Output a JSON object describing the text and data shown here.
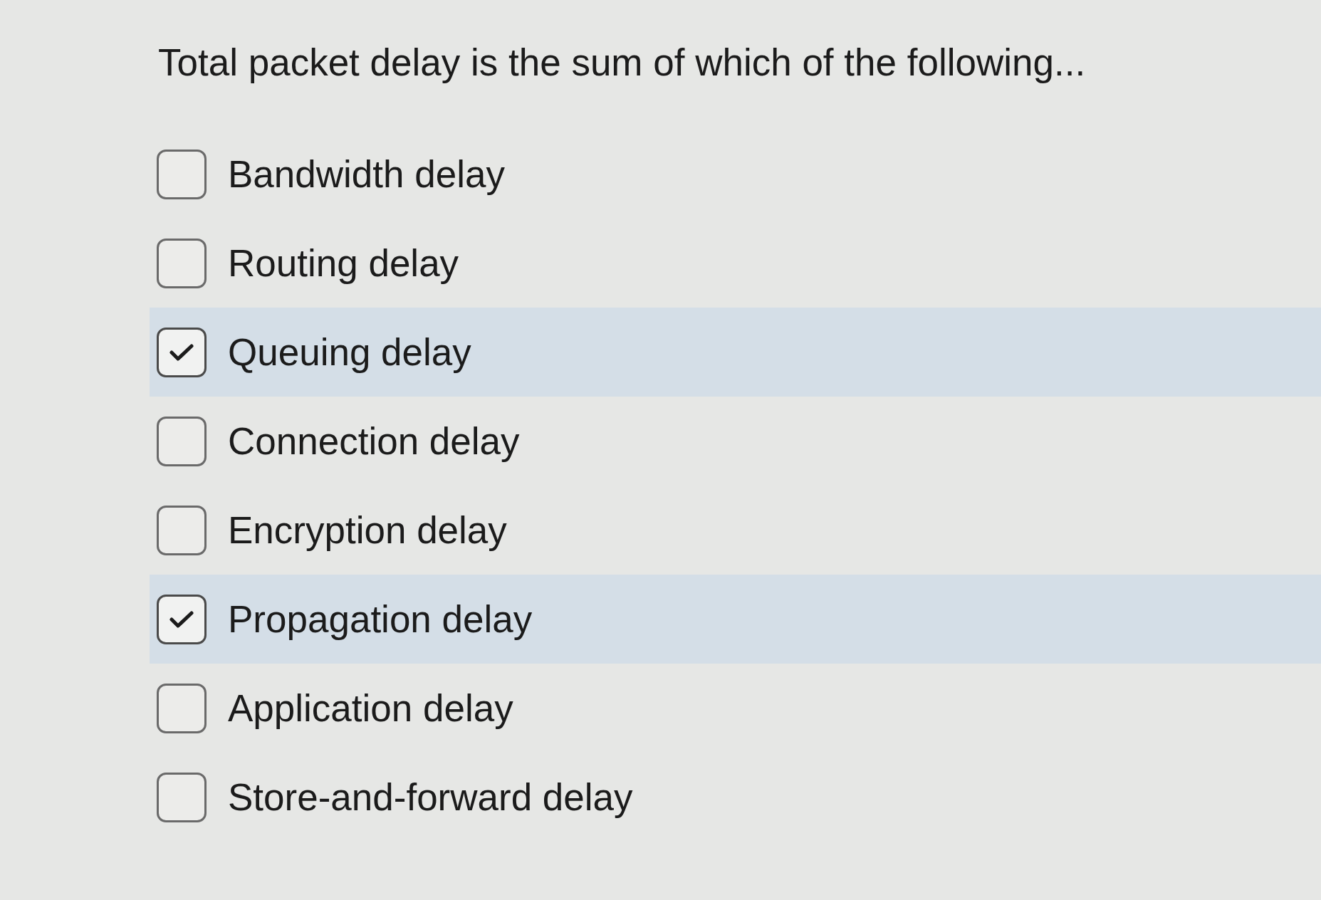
{
  "question": {
    "text": "Total packet delay is the sum of which of the following..."
  },
  "options": [
    {
      "label": "Bandwidth delay",
      "checked": false
    },
    {
      "label": "Routing delay",
      "checked": false
    },
    {
      "label": "Queuing delay",
      "checked": true
    },
    {
      "label": "Connection delay",
      "checked": false
    },
    {
      "label": "Encryption delay",
      "checked": false
    },
    {
      "label": "Propagation delay",
      "checked": true
    },
    {
      "label": "Application delay",
      "checked": false
    },
    {
      "label": "Store-and-forward delay",
      "checked": false
    }
  ]
}
